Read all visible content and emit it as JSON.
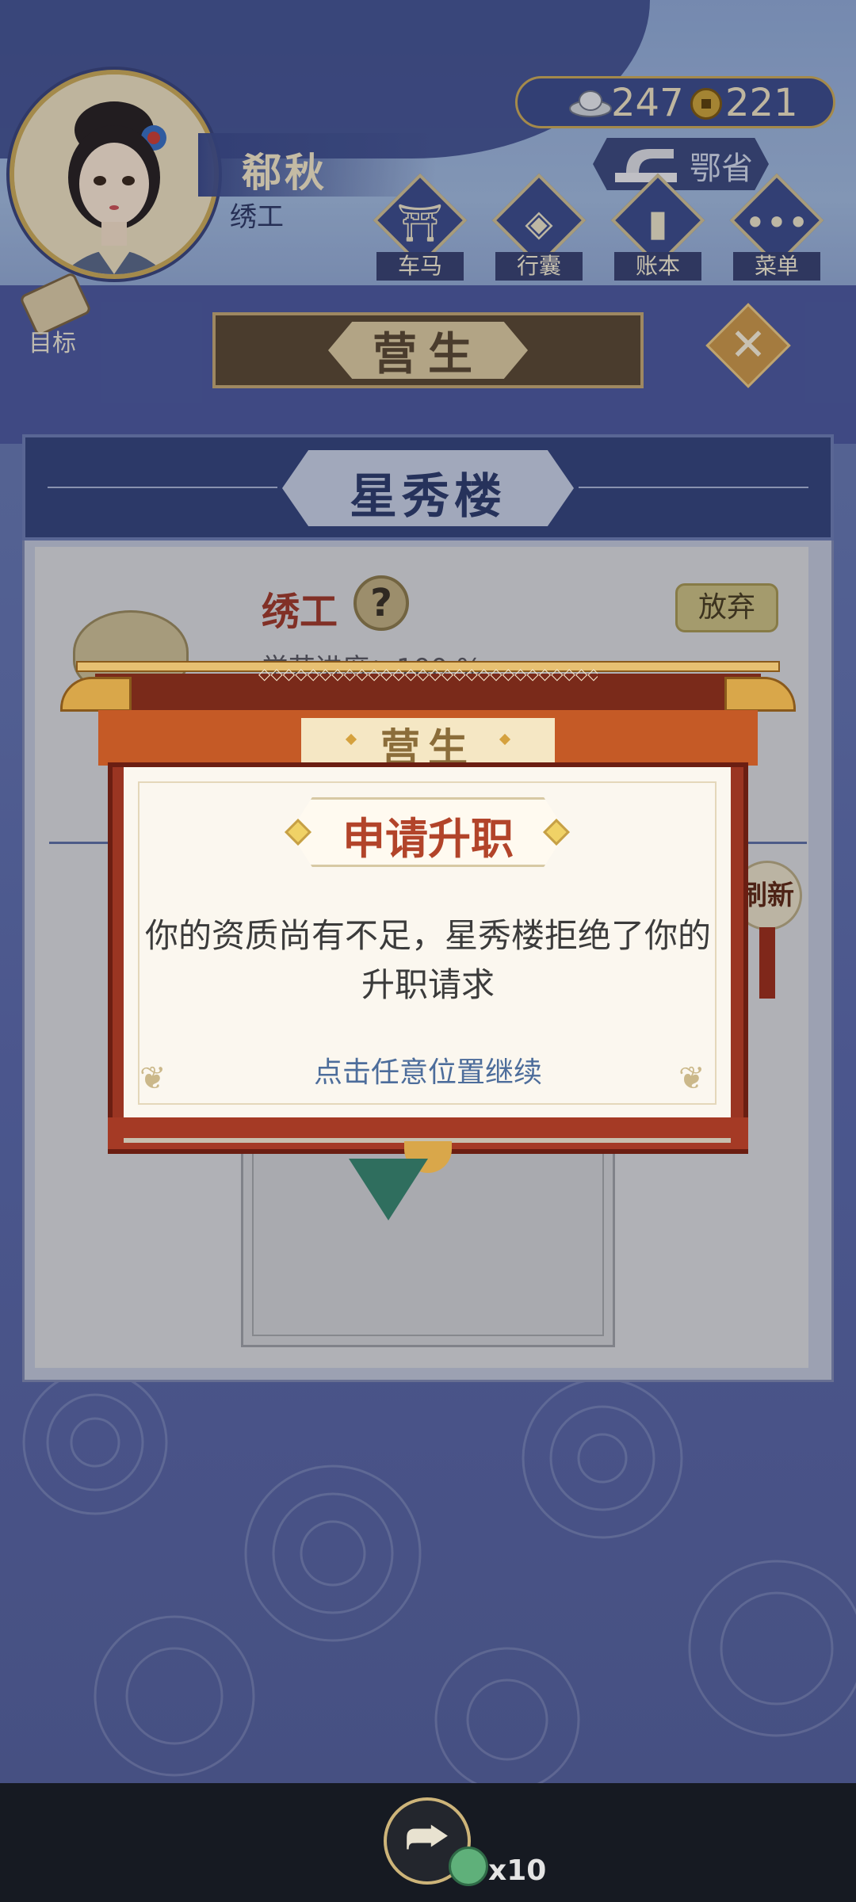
{
  "player": {
    "name": "郗秋",
    "title": "绣工"
  },
  "currency": {
    "silver": "247",
    "copper": "221",
    "silver_icon": "silver-ingot-icon",
    "copper_icon": "copper-coin-icon"
  },
  "location": {
    "label": "鄂省",
    "icon": "sewing-machine-icon"
  },
  "menu": [
    {
      "label": "车马",
      "icon": "carriage-icon",
      "glyph": "⛩"
    },
    {
      "label": "行囊",
      "icon": "bag-icon",
      "glyph": "◈"
    },
    {
      "label": "账本",
      "icon": "ledger-icon",
      "glyph": "▮"
    },
    {
      "label": "菜单",
      "icon": "more-icon",
      "glyph": "•••"
    }
  ],
  "goal": {
    "label": "目标"
  },
  "banner": {
    "title": "营生"
  },
  "building": {
    "name": "星秀楼",
    "job_title": "绣工",
    "help_glyph": "?",
    "quit_label": "放弃",
    "progress_peek": "学艺进度：100 %",
    "refresh_label": "刷新"
  },
  "modal": {
    "header": "营生",
    "title": "申请升职",
    "message": "你的资质尚有不足，星秀楼拒绝了你的升职请求",
    "hint": "点击任意位置继续",
    "pattern": "◇◇◇◇◇◇◇◇◇◇◇◇◇◇◇◇◇◇◇◇◇◇◇◇◇◇◇◇◇◇◇◇◇◇◇◇◇◇◇◇◇◇◇"
  },
  "navbar": {
    "share_glyph": "⮫",
    "reward_count": "x10"
  },
  "colors": {
    "frame_red": "#9a3522",
    "title_red": "#b2442a",
    "navy": "#3e4d8e",
    "gold": "#c9a95c"
  }
}
